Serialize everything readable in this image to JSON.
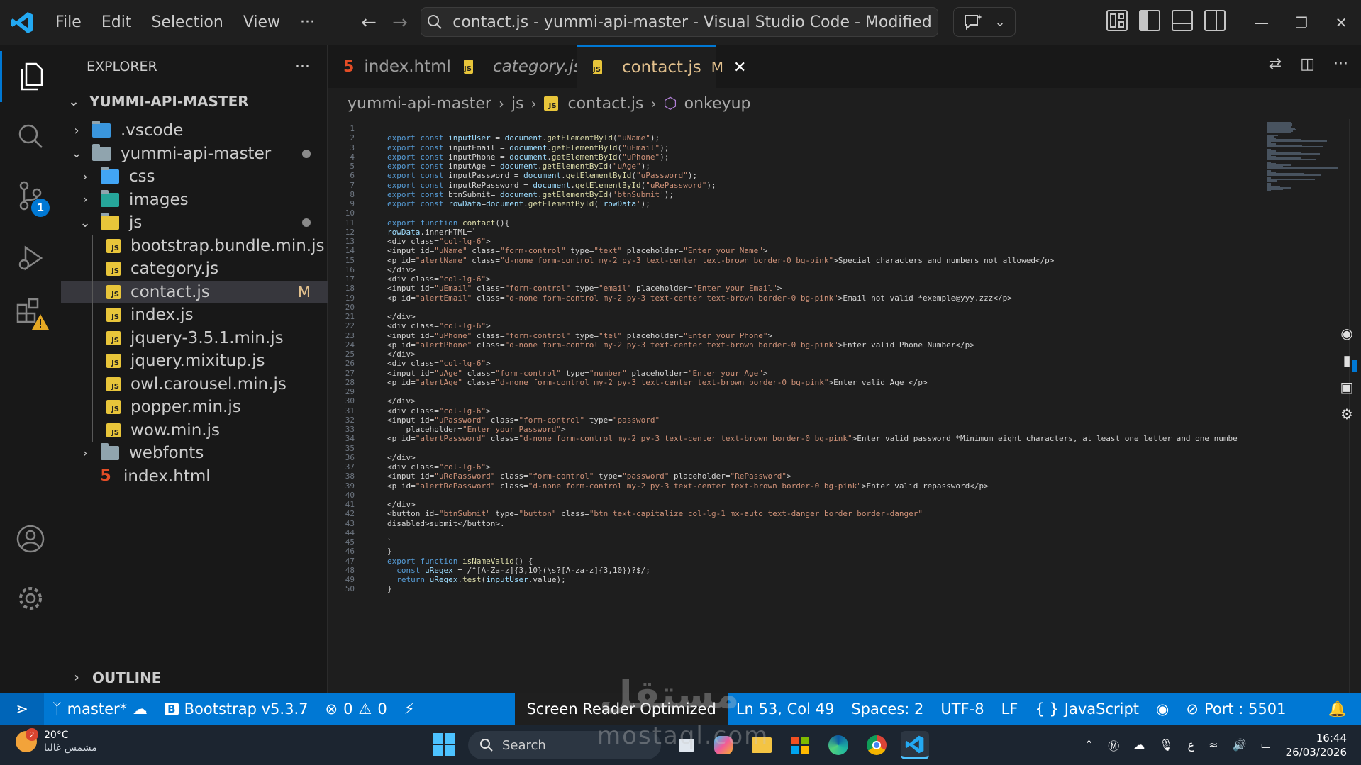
{
  "titlebar": {
    "menus": [
      "File",
      "Edit",
      "Selection",
      "View",
      "···"
    ],
    "search_text": "contact.js - yummi-api-master - Visual Studio Code - Modified",
    "win_minimize": "—",
    "win_restore": "❐",
    "win_close": "✕"
  },
  "activitybar": {
    "scm_badge": "1"
  },
  "sidebar": {
    "title": "EXPLORER",
    "more": "···",
    "root": "YUMMI-API-MASTER",
    "tree": [
      {
        "label": ".vscode",
        "chev": "›",
        "type": "vscode-folder"
      },
      {
        "label": "yummi-api-master",
        "chev": "⌄",
        "type": "folder-open",
        "dot": true
      },
      {
        "label": "css",
        "chev": "›",
        "type": "css-folder"
      },
      {
        "label": "images",
        "chev": "›",
        "type": "images-folder"
      },
      {
        "label": "js",
        "chev": "⌄",
        "type": "js-folder",
        "dot": true
      },
      {
        "label": "bootstrap.bundle.min.js",
        "type": "js"
      },
      {
        "label": "category.js",
        "type": "js"
      },
      {
        "label": "contact.js",
        "type": "js",
        "mod": "M",
        "selected": true
      },
      {
        "label": "index.js",
        "type": "js"
      },
      {
        "label": "jquery-3.5.1.min.js",
        "type": "js"
      },
      {
        "label": "jquery.mixitup.js",
        "type": "js"
      },
      {
        "label": "owl.carousel.min.js",
        "type": "js"
      },
      {
        "label": "popper.min.js",
        "type": "js"
      },
      {
        "label": "wow.min.js",
        "type": "js"
      },
      {
        "label": "webfonts",
        "chev": "›",
        "type": "folder"
      },
      {
        "label": "index.html",
        "type": "html"
      }
    ],
    "outline": "OUTLINE"
  },
  "tabs": [
    {
      "label": "index.html",
      "type": "html",
      "italic": false
    },
    {
      "label": "category.js",
      "type": "js",
      "italic": true
    },
    {
      "label": "contact.js",
      "type": "js",
      "italic": false,
      "mod": "M",
      "active": true
    }
  ],
  "breadcrumb": [
    "yummi-api-master",
    "js",
    "contact.js",
    "onkeyup"
  ],
  "code": {
    "lines": [
      "",
      "export const inputUser = document.getElementById(\"uName\");",
      "export const inputEmail = document.getElementById(\"uEmail\");",
      "export const inputPhone = document.getElementById(\"uPhone\");",
      "export const inputAge = document.getElementById(\"uAge\");",
      "export const inputPassword = document.getElementById(\"uPassword\");",
      "export const inputRePassword = document.getElementById(\"uRePassword\");",
      "export const btnSubmit= document.getElementById('btnSubmit');",
      "export const rowData=document.getElementById('rowData');",
      "",
      "export function contact(){",
      "rowData.innerHTML=`",
      "<div class=\"col-lg-6\">",
      "<input id=\"uName\" class=\"form-control\" type=\"text\" placeholder=\"Enter your Name\">",
      "<p id=\"alertName\" class=\"d-none form-control my-2 py-3 text-center text-brown border-0 bg-pink\">Special characters and numbers not allowed</p>",
      "</div>",
      "<div class=\"col-lg-6\">",
      "<input id=\"uEmail\" class=\"form-control\" type=\"email\" placeholder=\"Enter your Email\">",
      "<p id=\"alertEmail\" class=\"d-none form-control my-2 py-3 text-center text-brown border-0 bg-pink\">Email not valid *exemple@yyy.zzz</p>",
      "",
      "</div>",
      "<div class=\"col-lg-6\">",
      "<input id=\"uPhone\" class=\"form-control\" type=\"tel\" placeholder=\"Enter your Phone\">",
      "<p id=\"alertPhone\" class=\"d-none form-control my-2 py-3 text-center text-brown border-0 bg-pink\">Enter valid Phone Number</p>",
      "</div>",
      "<div class=\"col-lg-6\">",
      "<input id=\"uAge\" class=\"form-control\" type=\"number\" placeholder=\"Enter your Age\">",
      "<p id=\"alertAge\" class=\"d-none form-control my-2 py-3 text-center text-brown border-0 bg-pink\">Enter valid Age </p>",
      "",
      "</div>",
      "<div class=\"col-lg-6\">",
      "<input id=\"uPassword\" class=\"form-control\" type=\"password\"",
      "    placeholder=\"Enter your Password\">",
      "<p id=\"alertPassword\" class=\"d-none form-control my-2 py-3 text-center text-brown border-0 bg-pink\">Enter valid password *Minimum eight characters, at least one letter and one numbe",
      "",
      "</div>",
      "<div class=\"col-lg-6\">",
      "<input id=\"uRePassword\" class=\"form-control\" type=\"password\" placeholder=\"RePassword\">",
      "<p id=\"alertRePassword\" class=\"d-none form-control my-2 py-3 text-center text-brown border-0 bg-pink\">Enter valid repassword</p>",
      "",
      "</div>",
      "<button id=\"btnSubmit\" type=\"button\" class=\"btn text-capitalize col-lg-1 mx-auto text-danger border border-danger\"",
      "disabled>submit</button>.",
      "",
      "`",
      "}",
      "export function isNameValid() {",
      "  const uRegex = /^[A-Za-z]{3,10}(\\s?[A-za-z]{3,10})?$/;",
      "  return uRegex.test(inputUser.value);",
      "}"
    ]
  },
  "statusbar": {
    "branch": "master*",
    "bootstrap": "Bootstrap v5.3.7",
    "errors": "0",
    "warnings": "0",
    "screen_reader": "Screen Reader Optimized",
    "position": "Ln 53, Col 49",
    "spaces": "Spaces: 2",
    "encoding": "UTF-8",
    "eol": "LF",
    "language": "JavaScript",
    "port": "Port : 5501"
  },
  "taskbar": {
    "weather_temp": "20°C",
    "weather_desc": "مشمس غالبا",
    "weather_badge": "2",
    "search": "Search",
    "time": "16:44",
    "date": "26/03/2026",
    "lang": "ع"
  },
  "watermark": {
    "logo_text": "مستقل",
    "site": "mostaql.com"
  }
}
